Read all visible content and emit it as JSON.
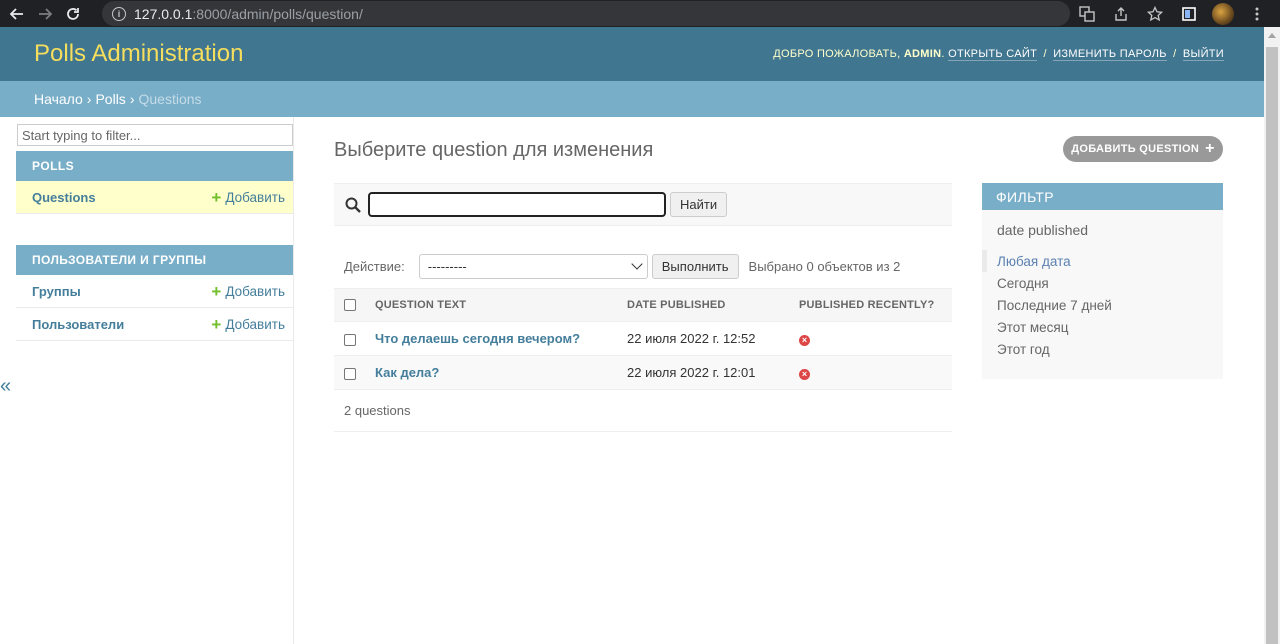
{
  "browser": {
    "url_host": "127.0.0.1",
    "url_rest": ":8000/admin/polls/question/"
  },
  "header": {
    "branding": "Polls Administration",
    "welcome": "Добро пожаловать,",
    "username": "admin",
    "view_site": "Открыть сайт",
    "change_password": "Изменить пароль",
    "logout": "Выйти",
    "separator": "/"
  },
  "breadcrumbs": {
    "home": "Начало",
    "app": "Polls",
    "current": "Questions",
    "separator": "›"
  },
  "sidebar": {
    "filter_placeholder": "Start typing to filter...",
    "modules": [
      {
        "caption": "Polls",
        "rows": [
          {
            "model": "Questions",
            "add": "Добавить",
            "current": true
          }
        ]
      },
      {
        "caption": "Пользователи и группы",
        "rows": [
          {
            "model": "Группы",
            "add": "Добавить",
            "current": false
          },
          {
            "model": "Пользователи",
            "add": "Добавить",
            "current": false
          }
        ]
      }
    ],
    "toggle": "«"
  },
  "content": {
    "title": "Выберите question для изменения",
    "add_button": "Добавить question"
  },
  "search": {
    "value": "",
    "submit": "Найти"
  },
  "actions": {
    "label": "Действие:",
    "selected_option": "---------",
    "go": "Выполнить",
    "counter": "Выбрано 0 объектов из 2"
  },
  "table": {
    "columns": [
      "Question text",
      "Date published",
      "Published recently?"
    ],
    "rows": [
      {
        "question_text": "Что делаешь сегодня вечером?",
        "date_published": "22 июля 2022 г. 12:52",
        "published_recently": false
      },
      {
        "question_text": "Как дела?",
        "date_published": "22 июля 2022 г. 12:01",
        "published_recently": false
      }
    ]
  },
  "paginator": "2 questions",
  "filter": {
    "title": "Фильтр",
    "heading": "date published",
    "options": [
      {
        "label": "Любая дата",
        "selected": true
      },
      {
        "label": "Сегодня",
        "selected": false
      },
      {
        "label": "Последние 7 дней",
        "selected": false
      },
      {
        "label": "Этот месяц",
        "selected": false
      },
      {
        "label": "Этот год",
        "selected": false
      }
    ]
  },
  "colors": {
    "header_bg": "#417690",
    "branding": "#f5dd5d",
    "breadcrumbs_bg": "#79aec8",
    "link": "#447e9b",
    "current_row_bg": "#ffffcc",
    "add_plus": "#70bf2b",
    "no_icon": "#dd4646"
  }
}
